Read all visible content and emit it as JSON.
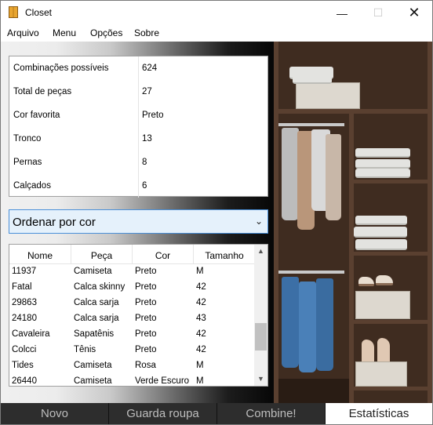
{
  "window": {
    "title": "Closet"
  },
  "menu": [
    "Arquivo",
    "Menu",
    "Opções",
    "Sobre"
  ],
  "stats": [
    {
      "label": "Combinações possíveis",
      "value": "624"
    },
    {
      "label": "Total de peças",
      "value": "27"
    },
    {
      "label": "Cor favorita",
      "value": "Preto"
    },
    {
      "label": "Tronco",
      "value": "13"
    },
    {
      "label": "Pernas",
      "value": "8"
    },
    {
      "label": "Calçados",
      "value": "6"
    }
  ],
  "sort": {
    "selected": "Ordenar por cor"
  },
  "table": {
    "columns": [
      "Nome",
      "Peça",
      "Cor",
      "Tamanho"
    ],
    "rows": [
      [
        "11937",
        "Camiseta",
        "Preto",
        "M"
      ],
      [
        "Fatal",
        "Calca skinny",
        "Preto",
        "42"
      ],
      [
        "29863",
        "Calca sarja",
        "Preto",
        "42"
      ],
      [
        "24180",
        "Calca sarja",
        "Preto",
        "43"
      ],
      [
        "Cavaleira",
        "Sapatênis",
        "Preto",
        "42"
      ],
      [
        "Colcci",
        "Tênis",
        "Preto",
        "42"
      ],
      [
        "Tides",
        "Camiseta",
        "Rosa",
        "M"
      ],
      [
        "26440",
        "Camiseta",
        "Verde Escuro",
        "M"
      ]
    ]
  },
  "tabs": [
    {
      "label": "Novo",
      "active": false
    },
    {
      "label": "Guarda roupa",
      "active": false
    },
    {
      "label": "Combine!",
      "active": false
    },
    {
      "label": "Estatísticas",
      "active": true
    }
  ],
  "colors": {
    "accent": "#4a90d9",
    "select_bg": "#e5f1fb",
    "tab_dark": "#2d2d2d"
  }
}
